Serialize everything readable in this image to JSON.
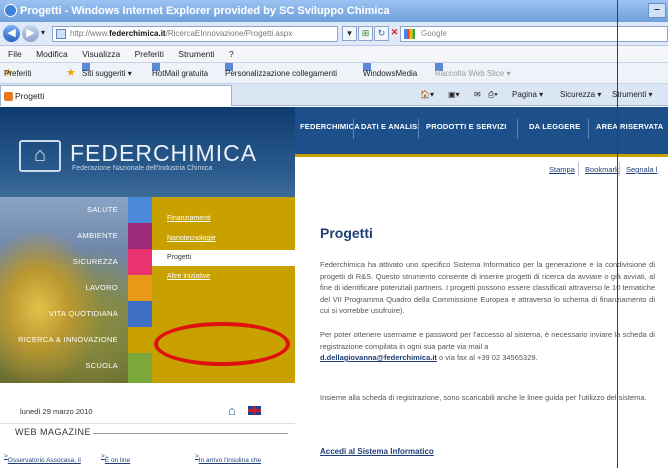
{
  "browser": {
    "title": "Progetti - Windows Internet Explorer provided by SC Sviluppo Chimica",
    "url_prefix": "http://www.",
    "url_domain": "federchimica.it",
    "url_path": "/RicercaEInnovazione/Progetti.aspx",
    "search_placeholder": "Google",
    "menu": [
      "File",
      "Modifica",
      "Visualizza",
      "Preferiti",
      "Strumenti",
      "?"
    ],
    "favorites": {
      "label": "Preferiti",
      "items": [
        "Siti suggeriti ▾",
        "HotMail gratuita",
        "Personalizzazione collegamenti",
        "WindowsMedia",
        "Raccolta Web Slice ▾"
      ]
    },
    "tab_label": "Progetti",
    "toolbar": {
      "page": "Pagina ▾",
      "security": "Sicurezza ▾",
      "tools": "Strumenti ▾"
    }
  },
  "site": {
    "logo_name": "FEDERCHIMICA",
    "logo_sub": "Federazione Nazionale dell'Industria Chimica",
    "topnav": [
      "FEDERCHIMICA",
      "DATI E ANALISI",
      "PRODOTTI E SERVIZI",
      "DA LEGGERE",
      "AREA RISERVATA"
    ],
    "tools": [
      "Stampa",
      "Bookmark",
      "Segnala l"
    ],
    "left_menu": [
      {
        "label": "SALUTE",
        "color": "#4a8ad8"
      },
      {
        "label": "AMBIENTE",
        "color": "#9a2a7a"
      },
      {
        "label": "SICUREZZA",
        "color": "#e8336f"
      },
      {
        "label": "LAVORO",
        "color": "#e79b19"
      },
      {
        "label": "VITA QUOTIDIANA",
        "color": "#3e6fc2"
      },
      {
        "label": "RICERCA & INNOVAZIONE",
        "color": "#c8a000"
      },
      {
        "label": "SCUOLA",
        "color": "#7aa83a"
      }
    ],
    "sub_menu": [
      "Finanziamenti",
      "Nanotecnologie",
      "Progetti",
      "Altre iniziative"
    ],
    "date": "lunedì 29 marzo 2010",
    "web_magazine": "WEB MAGAZINE",
    "magazine_links": [
      "Osservatorio Assocasa, il",
      "È on line",
      "In arrivo l'insulina che"
    ]
  },
  "content": {
    "title": "Progetti",
    "p1": "Federchimica ha attivato uno specifico Sistema Informatico per la generazione e la condivisione di progetti di R&S. Questo strumento consente di inserire progetti di ricerca da avviare o già avviati, al fine di identificare potenziali partners. I progetti possono essere classificati attraverso le 10 tematiche del VII Programma Quadro della Commissione Europea e attraverso lo schema di finanziamento di cui si vorrebbe usufruire).",
    "p2": "Per poter ottenere username e password per l'accesso al sistema, è necessario inviare la scheda di registrazione compilata in ogni sua parte via mail a",
    "email": "d.dellagiovanna@federchimica.it",
    "p2_tail": "o via fax al +39 02 34565329.",
    "p3": "Insieme alla scheda di registrazione, sono scaricabili anche le linee guida per l'utilizzo del sistema.",
    "access_link": "Accedi al Sistema Informatico"
  }
}
